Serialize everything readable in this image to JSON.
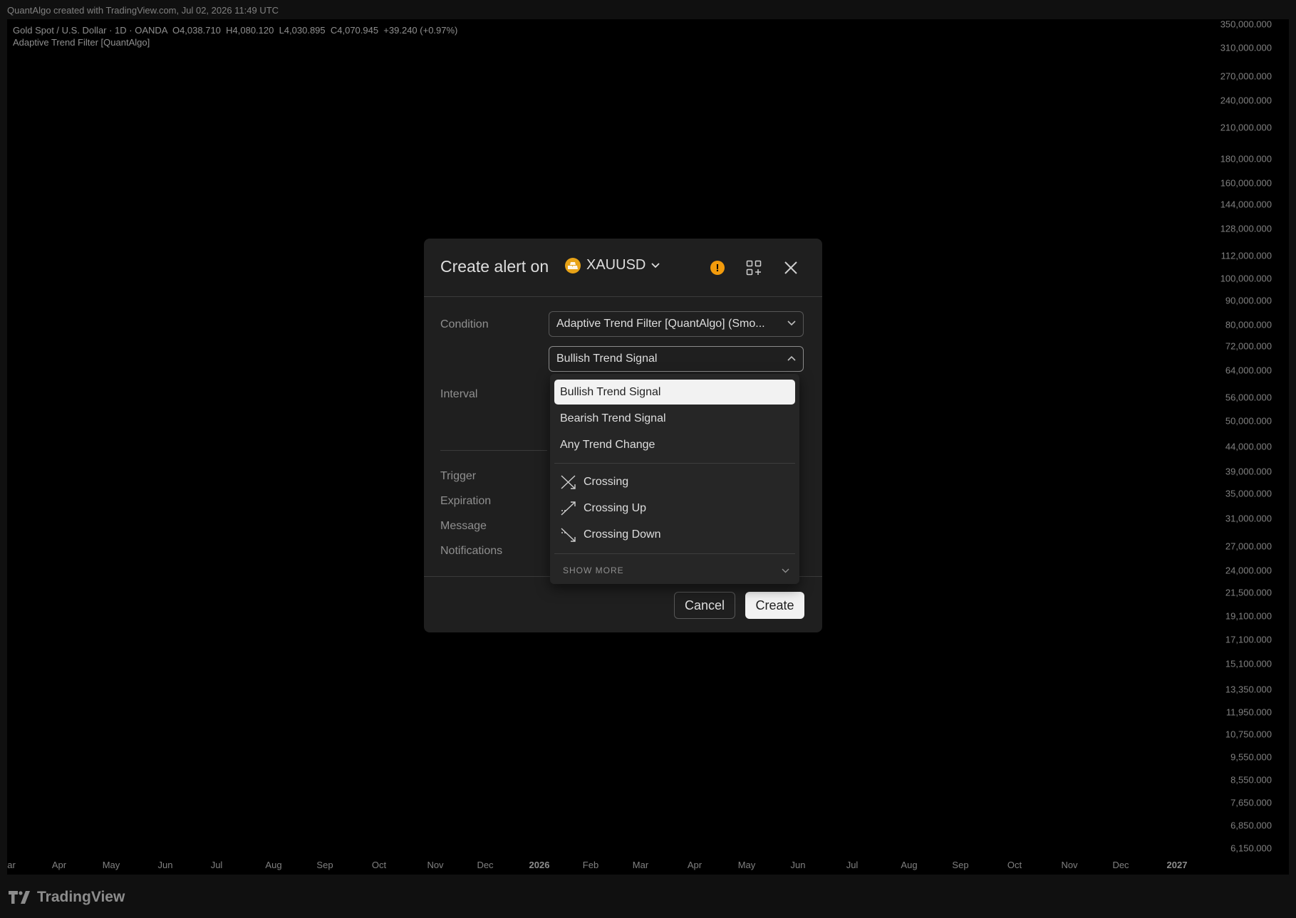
{
  "caption": "QuantAlgo created with TradingView.com, Jul 02, 2026 11:49 UTC",
  "chart": {
    "symbol_line": "Gold Spot / U.S. Dollar · 1D · OANDA  O4,038.710  H4,080.120  L4,030.895  C4,070.945  +39.240 (+0.97%)",
    "indicator_line": "Adaptive Trend Filter [QuantAlgo]",
    "price_labels": [
      "350,000.000",
      "310,000.000",
      "270,000.000",
      "240,000.000",
      "210,000.000",
      "180,000.000",
      "160,000.000",
      "144,000.000",
      "128,000.000",
      "112,000.000",
      "100,000.000",
      "90,000.000",
      "80,000.000",
      "72,000.000",
      "64,000.000",
      "56,000.000",
      "50,000.000",
      "44,000.000",
      "39,000.000",
      "35,000.000",
      "31,000.000",
      "27,000.000",
      "24,000.000",
      "21,500.000",
      "19,100.000",
      "17,100.000",
      "15,100.000",
      "13,350.000",
      "11,950.000",
      "10,750.000",
      "9,550.000",
      "8,550.000",
      "7,650.000",
      "6,850.000",
      "6,150.000"
    ],
    "time_labels": [
      "ar",
      "Apr",
      "May",
      "Jun",
      "Jul",
      "Aug",
      "Sep",
      "Oct",
      "Nov",
      "Dec",
      "2026",
      "Feb",
      "Mar",
      "Apr",
      "May",
      "Jun",
      "Jul",
      "Aug",
      "Sep",
      "Oct",
      "Nov",
      "Dec",
      "2027"
    ],
    "bold_time_labels": [
      "2026",
      "2027"
    ]
  },
  "logo": {
    "text": "TradingView"
  },
  "modal": {
    "title": "Create alert on",
    "symbol": "XAUUSD",
    "icons": [
      "warning-icon",
      "widgets-icon",
      "close-icon"
    ],
    "labels": {
      "condition": "Condition",
      "interval": "Interval",
      "trigger": "Trigger",
      "expiration": "Expiration",
      "message": "Message",
      "notifications": "Notifications"
    },
    "condition_value": "Adaptive Trend Filter [QuantAlgo] (Smo...",
    "signal_value": "Bullish Trend Signal",
    "cancel_label": "Cancel",
    "create_label": "Create"
  },
  "dropdown": {
    "options": [
      "Bullish Trend Signal",
      "Bearish Trend Signal",
      "Any Trend Change"
    ],
    "cross_options": [
      "Crossing",
      "Crossing Up",
      "Crossing Down"
    ],
    "show_more": "SHOW MORE",
    "selected": "Bullish Trend Signal"
  },
  "colors": {
    "background": "#1e1e1e",
    "chart_bg": "#000000",
    "modal_bg": "#1f1f1f",
    "warning": "#f29b0c",
    "gold": "#e8a317"
  }
}
